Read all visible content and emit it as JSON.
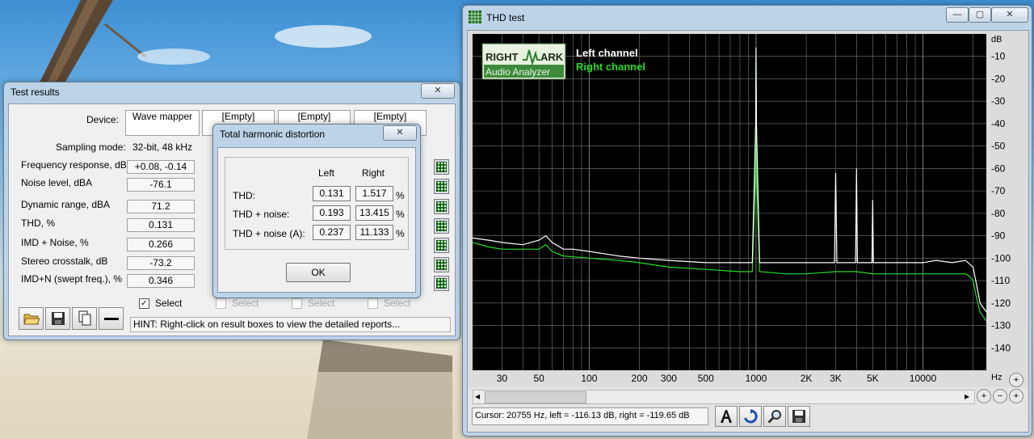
{
  "test_results": {
    "title": "Test results",
    "close": "✕",
    "device_label": "Device:",
    "devices": [
      "Wave mapper",
      "[Empty]",
      "[Empty]",
      "[Empty]"
    ],
    "sampling_label": "Sampling mode:",
    "sampling_value": "32-bit, 48 kHz",
    "rows": [
      {
        "label": "Frequency response, dB",
        "value": "+0.08, -0.14"
      },
      {
        "label": "Noise level, dBA",
        "value": "-76.1"
      },
      {
        "label": "Dynamic range, dBA",
        "value": "71.2"
      },
      {
        "label": "THD, %",
        "value": "0.131"
      },
      {
        "label": "IMD + Noise, %",
        "value": "0.266"
      },
      {
        "label": "Stereo crosstalk, dB",
        "value": "-73.2"
      },
      {
        "label": "IMD+N (swept freq.), %",
        "value": "0.346"
      }
    ],
    "select_label": "Select",
    "select_checked": "✓",
    "hint": "HINT: Right-click on result boxes to view the detailed reports..."
  },
  "thd_dialog": {
    "title": "Total harmonic distortion",
    "close": "✕",
    "col_left": "Left",
    "col_right": "Right",
    "unit": "%",
    "rows": [
      {
        "label": "THD:",
        "left": "0.131",
        "right": "1.517"
      },
      {
        "label": "THD + noise:",
        "left": "0.193",
        "right": "13.415"
      },
      {
        "label": "THD + noise (A):",
        "left": "0.237",
        "right": "11.133"
      }
    ],
    "ok": "OK"
  },
  "thd_window": {
    "title": "THD test",
    "minimize": "—",
    "maximize": "▢",
    "close": "✕",
    "cursor": "Cursor:  20755 Hz,  left = -116.13 dB,  right = -119.65 dB",
    "scroll_left": "◂",
    "scroll_right": "▸",
    "zoom_in": "+",
    "zoom_out": "−",
    "zoom_v": "+"
  },
  "chart_data": {
    "type": "line",
    "logo_top_left": "RIGHT",
    "logo_top_right": "ARK",
    "logo_bottom": "Audio Analyzer",
    "xlabel": "Hz",
    "ylabel": "dB",
    "x_scale": "log",
    "xlim": [
      20,
      24000
    ],
    "ylim": [
      -150,
      0
    ],
    "x_ticks": [
      30,
      50,
      100,
      200,
      300,
      500,
      1000,
      2000,
      3000,
      5000,
      10000
    ],
    "x_tick_labels": [
      "30",
      "50",
      "100",
      "200",
      "300",
      "500",
      "1000",
      "2K",
      "3K",
      "5K",
      "10000"
    ],
    "y_ticks": [
      -10,
      -20,
      -30,
      -40,
      -50,
      -60,
      -70,
      -80,
      -90,
      -100,
      -110,
      -120,
      -130,
      -140
    ],
    "y_tick_labels": [
      "-10",
      "-20",
      "-30",
      "-40",
      "-50",
      "-60",
      "-70",
      "-80",
      "-90",
      "-100",
      "-110",
      "-120",
      "-130",
      "-140"
    ],
    "grid": true,
    "legend": "top-left",
    "background": "#000000",
    "grid_color": "#7a7a7a",
    "series": [
      {
        "name": "Left channel",
        "color": "#ffffff",
        "points": [
          [
            20,
            -91
          ],
          [
            25,
            -92
          ],
          [
            30,
            -93
          ],
          [
            40,
            -94
          ],
          [
            50,
            -92
          ],
          [
            55,
            -90
          ],
          [
            60,
            -93
          ],
          [
            70,
            -96
          ],
          [
            80,
            -96
          ],
          [
            100,
            -97
          ],
          [
            150,
            -99
          ],
          [
            200,
            -100
          ],
          [
            300,
            -101
          ],
          [
            500,
            -102
          ],
          [
            800,
            -102
          ],
          [
            950,
            -102
          ],
          [
            995,
            -40
          ],
          [
            1000,
            -6
          ],
          [
            1005,
            -40
          ],
          [
            1050,
            -102
          ],
          [
            1500,
            -102
          ],
          [
            2000,
            -102
          ],
          [
            2950,
            -102
          ],
          [
            3000,
            -62
          ],
          [
            3050,
            -102
          ],
          [
            3950,
            -102
          ],
          [
            4000,
            -60
          ],
          [
            4050,
            -102
          ],
          [
            4950,
            -102
          ],
          [
            5000,
            -74
          ],
          [
            5050,
            -102
          ],
          [
            8000,
            -102
          ],
          [
            10000,
            -102
          ],
          [
            12000,
            -101
          ],
          [
            15000,
            -102
          ],
          [
            18000,
            -101
          ],
          [
            20000,
            -104
          ],
          [
            21000,
            -112
          ],
          [
            22000,
            -120
          ],
          [
            24000,
            -124
          ]
        ]
      },
      {
        "name": "Right channel",
        "color": "#22dd22",
        "points": [
          [
            20,
            -93
          ],
          [
            25,
            -95
          ],
          [
            30,
            -96
          ],
          [
            40,
            -96
          ],
          [
            50,
            -96
          ],
          [
            55,
            -94
          ],
          [
            60,
            -97
          ],
          [
            70,
            -99
          ],
          [
            100,
            -100
          ],
          [
            150,
            -101
          ],
          [
            200,
            -102
          ],
          [
            300,
            -104
          ],
          [
            500,
            -105
          ],
          [
            800,
            -106
          ],
          [
            950,
            -106
          ],
          [
            995,
            -60
          ],
          [
            1000,
            -10
          ],
          [
            1005,
            -60
          ],
          [
            1050,
            -106
          ],
          [
            1500,
            -107
          ],
          [
            2000,
            -107
          ],
          [
            3000,
            -106
          ],
          [
            4000,
            -106
          ],
          [
            5000,
            -107
          ],
          [
            8000,
            -107
          ],
          [
            10000,
            -107
          ],
          [
            12000,
            -107
          ],
          [
            15000,
            -107
          ],
          [
            18000,
            -107
          ],
          [
            19000,
            -108
          ],
          [
            20000,
            -110
          ],
          [
            21000,
            -118
          ],
          [
            22000,
            -124
          ],
          [
            24000,
            -128
          ]
        ]
      }
    ]
  }
}
